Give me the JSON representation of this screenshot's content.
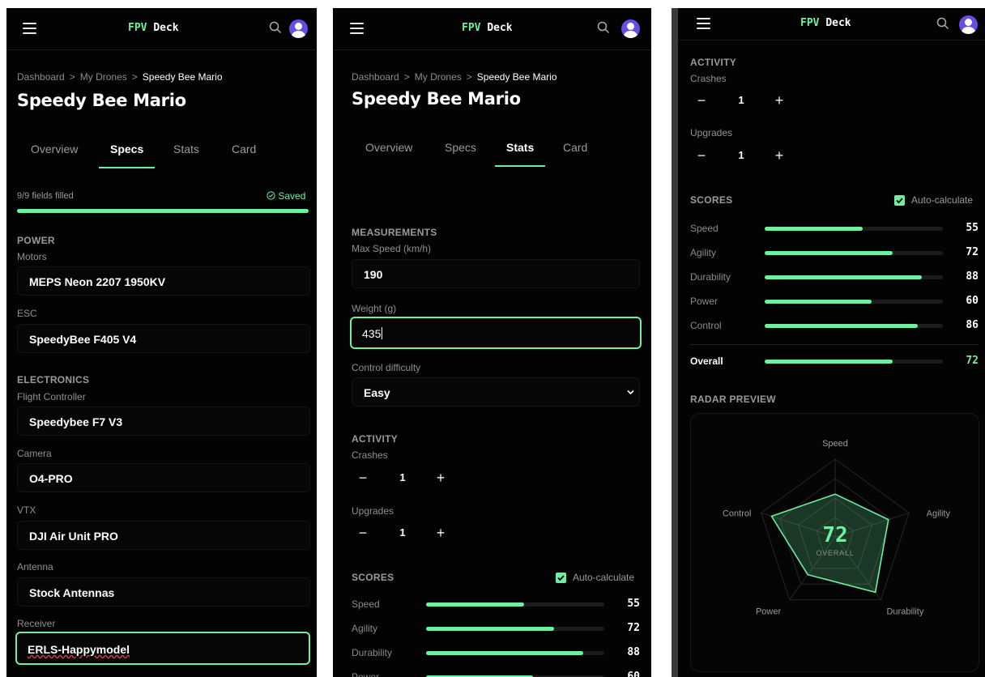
{
  "app": {
    "brand_a": "FPV",
    "brand_b": "Deck"
  },
  "colors": {
    "accent": "#6ef0a0",
    "background": "#030303",
    "avatar": "#6a4ce0"
  },
  "icons": [
    "menu-icon",
    "search-icon",
    "avatar-icon",
    "check-circle-icon",
    "chevron-down-icon",
    "checkbox-checked-icon"
  ],
  "breadcrumb": {
    "dashboard": "Dashboard",
    "sep": ">",
    "drones": "My Drones",
    "current": "Speedy Bee Mario"
  },
  "page": {
    "title": "Speedy Bee Mario"
  },
  "tabs": [
    "Overview",
    "Specs",
    "Stats",
    "Card"
  ],
  "specs": {
    "progress_label": "9/9 fields filled",
    "progress": 1.0,
    "saved_label": "Saved",
    "power": {
      "heading": "POWER",
      "motors_label": "Motors",
      "motors": "MEPS Neon 2207 1950KV",
      "esc_label": "ESC",
      "esc": "SpeedyBee F405 V4"
    },
    "electronics": {
      "heading": "ELECTRONICS",
      "fc_label": "Flight Controller",
      "fc": "Speedybee F7 V3",
      "camera_label": "Camera",
      "camera": "O4-PRO",
      "vtx_label": "VTX",
      "vtx": "DJI Air Unit PRO",
      "antenna_label": "Antenna",
      "antenna": "Stock Antennas",
      "receiver_label": "Receiver",
      "receiver": "ERLS-Happymodel"
    }
  },
  "stats": {
    "measurements": {
      "heading": "MEASUREMENTS",
      "speed_label": "Max Speed (km/h)",
      "speed": "190",
      "weight_label": "Weight (g)",
      "weight": "435",
      "difficulty_label": "Control difficulty",
      "difficulty": "Easy"
    },
    "activity": {
      "heading": "ACTIVITY",
      "crashes_label": "Crashes",
      "crashes": "1",
      "upgrades_label": "Upgrades",
      "upgrades": "1",
      "minus": "−",
      "plus": "+"
    },
    "scores": {
      "heading": "SCORES",
      "auto_label": "Auto-calculate",
      "auto_checked": true,
      "items": [
        {
          "name": "Speed",
          "value": 55
        },
        {
          "name": "Agility",
          "value": 72
        },
        {
          "name": "Durability",
          "value": 88
        },
        {
          "name": "Power",
          "value": 60
        },
        {
          "name": "Control",
          "value": 86
        }
      ],
      "overall_label": "Overall",
      "overall": 72
    },
    "radar": {
      "heading": "RADAR PREVIEW",
      "axes": [
        "Speed",
        "Agility",
        "Durability",
        "Power",
        "Control"
      ],
      "center_value": "72",
      "center_label": "OVERALL"
    }
  }
}
